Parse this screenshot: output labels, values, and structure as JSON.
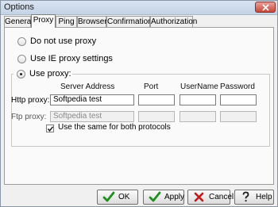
{
  "window": {
    "title": "Options"
  },
  "tabs": [
    {
      "label": "General"
    },
    {
      "label": "Proxy"
    },
    {
      "label": "Ping"
    },
    {
      "label": "Browser"
    },
    {
      "label": "Confirmations"
    },
    {
      "label": "Authorization"
    }
  ],
  "active_tab": "Proxy",
  "proxy": {
    "option_none": "Do not use proxy",
    "option_ie": "Use IE proxy settings",
    "option_use": "Use proxy:",
    "selected": "Use proxy:",
    "headers": {
      "server": "Server Address",
      "port": "Port",
      "username": "UserName",
      "password": "Password"
    },
    "http": {
      "label": "Http proxy:",
      "server": "Softpedia test",
      "port": "",
      "username": "",
      "password": ""
    },
    "ftp": {
      "label": "Ftp proxy:",
      "server": "Softpedia test",
      "port": "",
      "username": "",
      "password": ""
    },
    "same_for_both": {
      "label": "Use the same for both protocols",
      "checked": true
    }
  },
  "buttons": {
    "ok": "OK",
    "apply": "Apply",
    "cancel": "Cancel",
    "help": "Help"
  },
  "icons": {
    "ok": "check-icon",
    "apply": "check-icon",
    "cancel": "cross-icon",
    "help": "question-icon",
    "close": "close-icon"
  },
  "colors": {
    "check_green": "#1f8f1f",
    "cross_red": "#c21a1a"
  }
}
